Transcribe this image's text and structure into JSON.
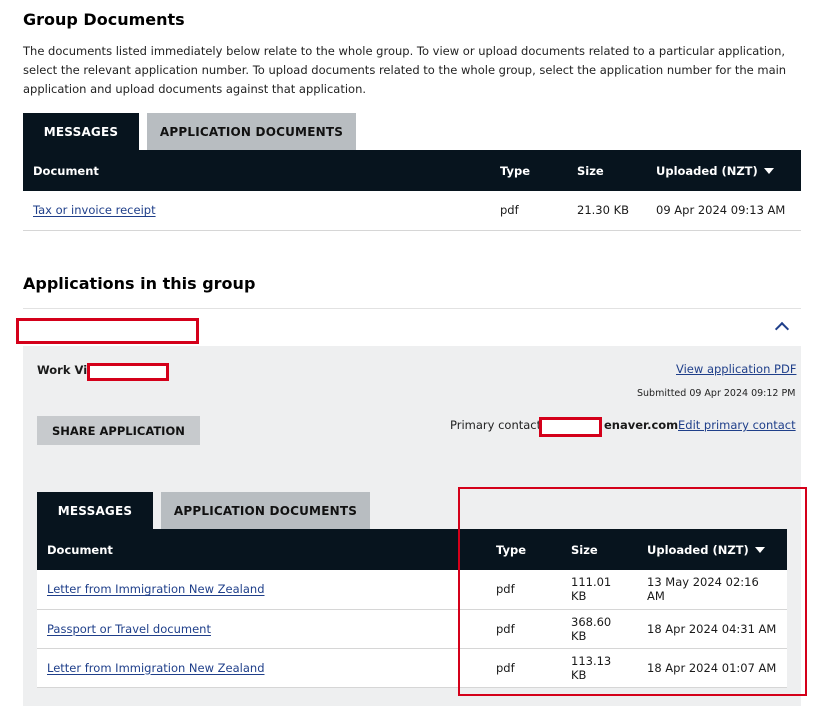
{
  "group_documents": {
    "title": "Group Documents",
    "description": "The documents listed immediately below relate to the whole group. To view or upload documents related to a particular application, select the relevant application number. To upload documents related to the whole group, select the application number for the main application and upload documents against that application.",
    "tabs": [
      {
        "label": "MESSAGES",
        "active": true
      },
      {
        "label": "APPLICATION DOCUMENTS",
        "active": false
      }
    ],
    "columns": {
      "document": "Document",
      "type": "Type",
      "size": "Size",
      "uploaded": "Uploaded (NZT)"
    },
    "rows": [
      {
        "document": "Tax or invoice receipt",
        "type": "pdf",
        "size": "21.30 KB",
        "uploaded": "09 Apr 2024 09:13 AM"
      }
    ]
  },
  "applications": {
    "title": "Applications in this group",
    "application": {
      "visa_type_prefix": "Work Vis",
      "view_pdf_label": "View application PDF",
      "submitted_text": "Submitted  09 Apr 2024 09:12 PM",
      "share_label": "SHARE APPLICATION",
      "primary_contact_label": "Primary contact:",
      "primary_contact_suffix": "enaver.com",
      "edit_contact_label": "Edit primary contact",
      "tabs": [
        {
          "label": "MESSAGES",
          "active": true
        },
        {
          "label": "APPLICATION DOCUMENTS",
          "active": false
        }
      ],
      "columns": {
        "document": "Document",
        "type": "Type",
        "size": "Size",
        "uploaded": "Uploaded (NZT)"
      },
      "rows": [
        {
          "document": "Letter from Immigration New Zealand",
          "type": "pdf",
          "size": "111.01 KB",
          "uploaded": "13 May 2024 02:16 AM"
        },
        {
          "document": "Passport or Travel document",
          "type": "pdf",
          "size": "368.60 KB",
          "uploaded": "18 Apr 2024 04:31 AM"
        },
        {
          "document": "Letter from Immigration New Zealand",
          "type": "pdf",
          "size": "113.13 KB",
          "uploaded": "18 Apr 2024 01:07 AM"
        }
      ]
    }
  },
  "colors": {
    "dark_header": "#07141e",
    "link": "#1f3f8a",
    "redaction": "#d4001a",
    "panel": "#eeeff0"
  }
}
